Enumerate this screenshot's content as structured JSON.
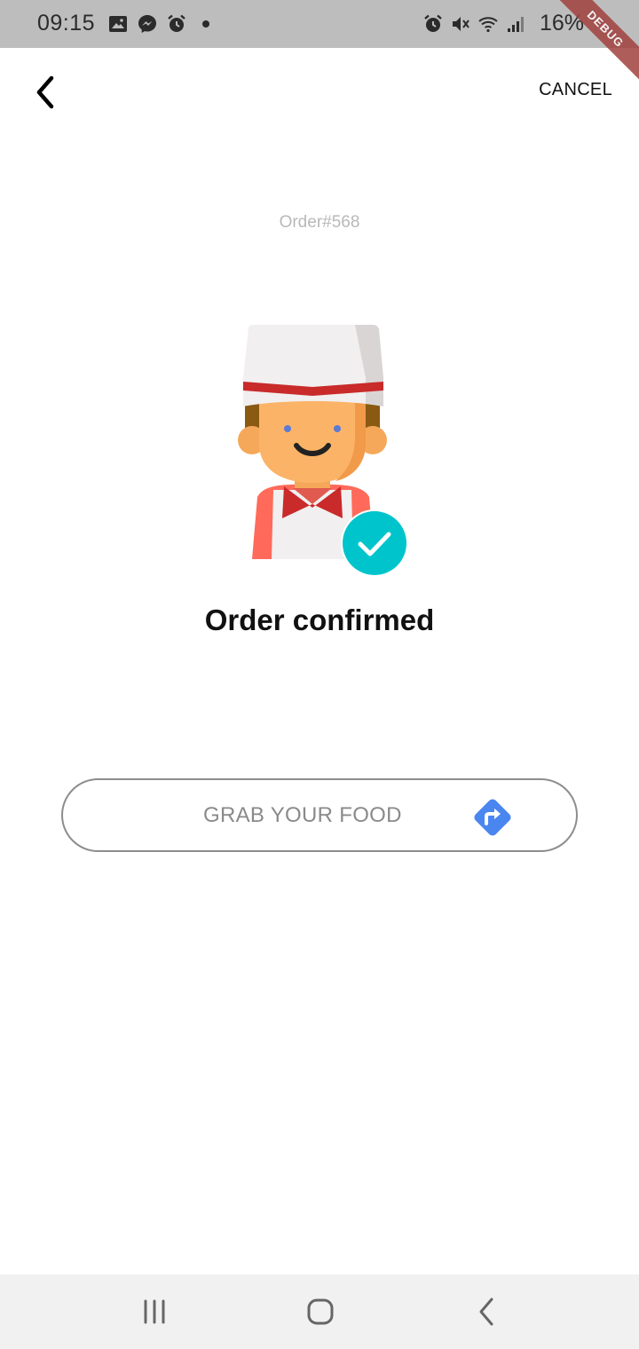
{
  "status_bar": {
    "time": "09:15",
    "battery": "16%",
    "left_icons": [
      "image-icon",
      "messenger-icon",
      "alarm-icon",
      "dot-icon"
    ],
    "right_icons": [
      "alarm-icon",
      "mute-icon",
      "wifi-icon",
      "signal-icon"
    ]
  },
  "debug_banner": "DEBUG",
  "app_bar": {
    "back_icon": "chevron-left-icon",
    "cancel_label": "CANCEL"
  },
  "order": {
    "number_label": "Order#568",
    "status_title": "Order confirmed"
  },
  "action": {
    "label": "GRAB YOUR FOOD",
    "icon": "directions-icon"
  },
  "nav_bar": {
    "items": [
      "recents-icon",
      "home-icon",
      "back-icon"
    ]
  },
  "colors": {
    "accent_check": "#00c4cc",
    "directions_blue": "#4a86f0",
    "hat_red": "#c92a2a",
    "apron_red": "#e05a4f"
  }
}
